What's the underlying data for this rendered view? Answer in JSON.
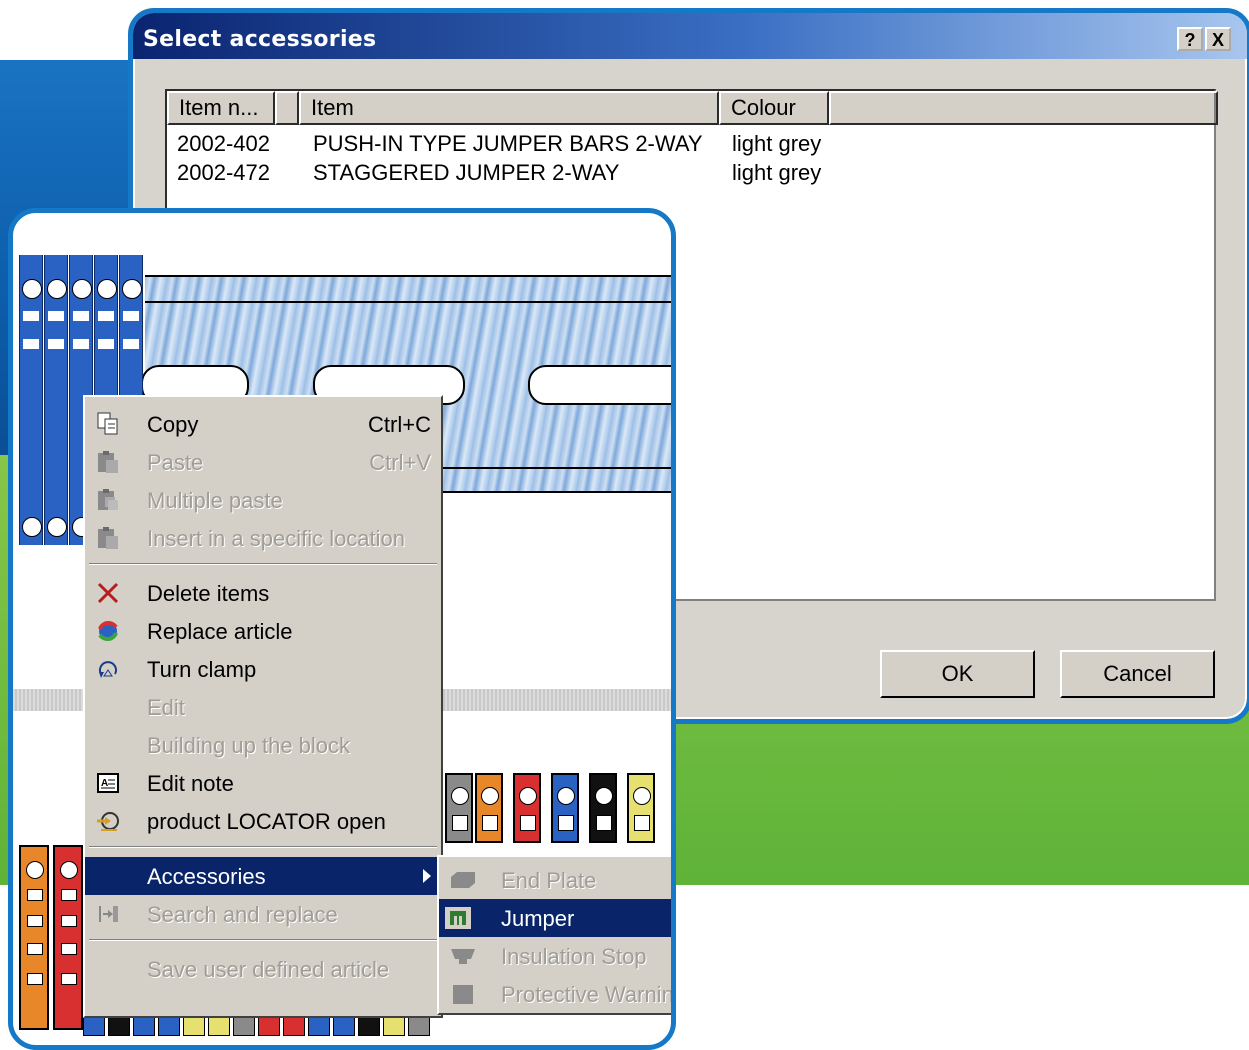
{
  "dialog": {
    "title": "Select accessories",
    "help_label": "?",
    "close_label": "X",
    "columns": [
      "Item n...",
      "",
      "Item",
      "Colour"
    ],
    "rows": [
      {
        "item_number": "2002-402",
        "item": "PUSH-IN TYPE JUMPER BARS 2-WAY",
        "colour": "light grey"
      },
      {
        "item_number": "2002-472",
        "item": "STAGGERED JUMPER 2-WAY",
        "colour": "light grey"
      }
    ],
    "ok_label": "OK",
    "cancel_label": "Cancel"
  },
  "context_menu": {
    "items": [
      {
        "label": "Copy",
        "shortcut": "Ctrl+C",
        "enabled": true,
        "icon": "copy-icon"
      },
      {
        "label": "Paste",
        "shortcut": "Ctrl+V",
        "enabled": false,
        "icon": "paste-icon"
      },
      {
        "label": "Multiple paste",
        "enabled": false,
        "icon": "multiple-paste-icon"
      },
      {
        "label": "Insert in a specific location",
        "enabled": false,
        "icon": "insert-location-icon"
      },
      {
        "label": "Delete items",
        "enabled": true,
        "icon": "delete-icon"
      },
      {
        "label": "Replace article",
        "enabled": true,
        "icon": "replace-icon"
      },
      {
        "label": "Turn clamp",
        "enabled": true,
        "icon": "turn-clamp-icon"
      },
      {
        "label": "Edit",
        "enabled": false
      },
      {
        "label": "Building up the block",
        "enabled": false
      },
      {
        "label": "Edit note",
        "enabled": true,
        "icon": "note-icon"
      },
      {
        "label": "product LOCATOR open",
        "enabled": true,
        "icon": "locator-icon"
      },
      {
        "label": "Accessories",
        "enabled": true,
        "selected": true
      },
      {
        "label": "Search and replace",
        "enabled": false,
        "icon": "search-replace-icon"
      },
      {
        "label": "Save user defined article",
        "enabled": false
      }
    ]
  },
  "accessories_submenu": {
    "items": [
      {
        "label": "End Plate",
        "enabled": false,
        "icon": "end-plate-icon"
      },
      {
        "label": "Jumper",
        "enabled": true,
        "selected": true,
        "icon": "jumper-icon"
      },
      {
        "label": "Insulation Stop",
        "enabled": false,
        "icon": "insulation-stop-icon"
      },
      {
        "label": "Protective Warnin",
        "enabled": false,
        "icon": "protective-warning-icon"
      }
    ]
  },
  "colors": {
    "frame_blue": "#1579c8",
    "title_dark": "#0a246a",
    "menu_bg": "#d4d0c8",
    "bg_blue": "#0d5fad",
    "bg_green": "#6dbb3f"
  }
}
